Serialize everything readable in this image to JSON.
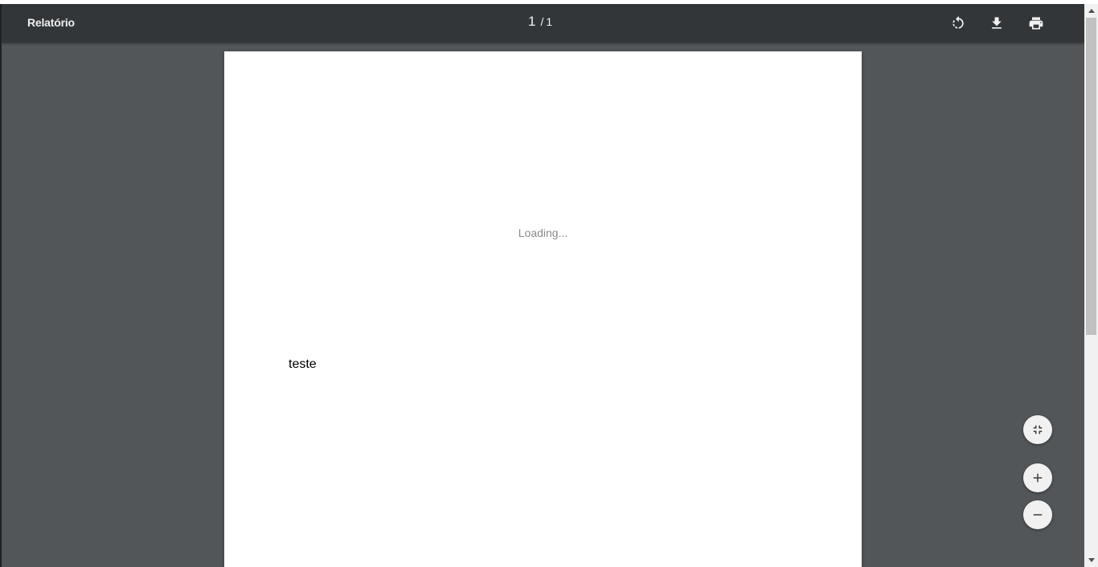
{
  "toolbar": {
    "title": "Relatório",
    "page_current": "1",
    "page_separator": "/",
    "page_total": "1",
    "rotate_icon": "rotate-icon",
    "download_icon": "download-icon",
    "print_icon": "print-icon"
  },
  "page": {
    "loading_text": "Loading...",
    "body_text": "teste"
  },
  "zoom_controls": {
    "fit_icon": "fit-to-page-icon",
    "zoom_in_icon": "plus-icon",
    "zoom_out_icon": "minus-icon"
  },
  "colors": {
    "toolbar_bg": "#323639",
    "viewer_bg": "#525659",
    "page_bg": "#ffffff",
    "toolbar_text": "#f1f1f1"
  }
}
